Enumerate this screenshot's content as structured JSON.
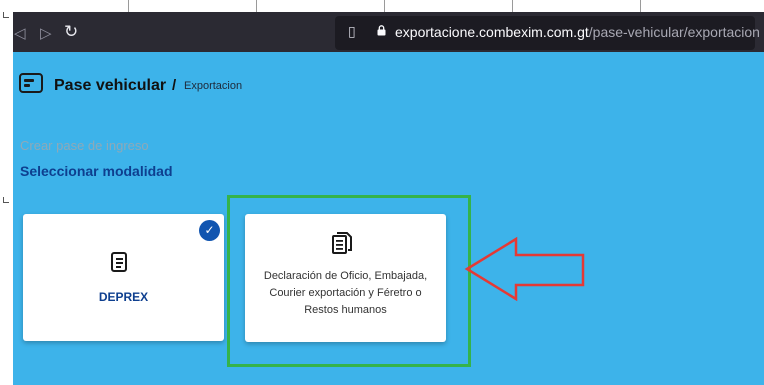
{
  "browser": {
    "back_icon": "back-icon",
    "forward_icon": "forward-icon",
    "reload_icon": "reload-icon",
    "bookmark_icon": "bookmark-icon",
    "url_host": "exportacione.combexim.com.gt",
    "url_path": "/pase-vehicular/exportacion"
  },
  "header": {
    "title": "Pase vehicular",
    "separator": "/",
    "breadcrumb": "Exportacion"
  },
  "main": {
    "subtitle": "Crear pase de ingreso",
    "section_title": "Seleccionar modalidad",
    "cards": [
      {
        "label": "DEPREX",
        "selected": true,
        "check": "✓"
      },
      {
        "label": "Declaración de Oficio, Embajada, Courier exportación y Féretro o Restos humanos",
        "selected": false
      }
    ]
  },
  "colors": {
    "page_bg": "#3db3ea",
    "accent": "#0e3f8f",
    "highlight_box": "#35b34a",
    "arrow": "#e53935"
  }
}
